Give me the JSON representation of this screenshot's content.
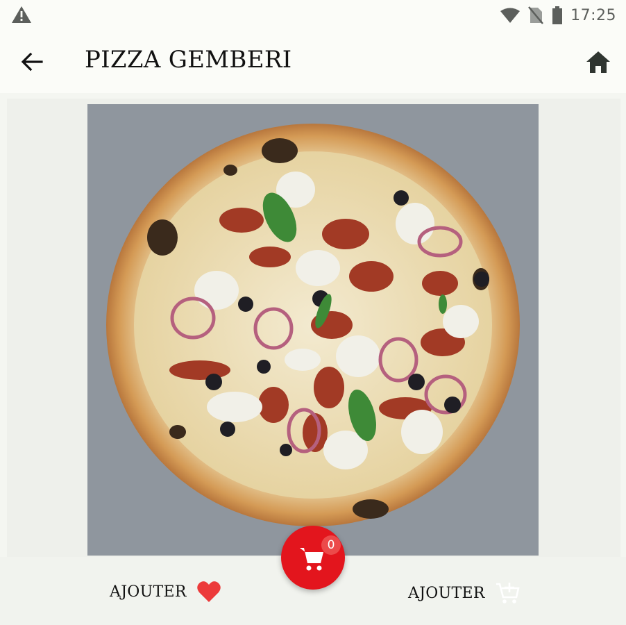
{
  "status_bar": {
    "time": "17:25",
    "icons": [
      "warning-icon",
      "wifi-icon",
      "no-sim-icon",
      "battery-icon"
    ]
  },
  "app_bar": {
    "title": "PIZZA GEMBERI",
    "back_icon": "arrow-back-icon",
    "home_icon": "home-icon"
  },
  "product": {
    "image": "pizza-photo"
  },
  "actions": {
    "favorite_label": "AJOUTER",
    "favorite_icon": "heart-icon",
    "cart_label": "AJOUTER",
    "cart_icon": "add-to-cart-icon"
  },
  "cart_fab": {
    "icon": "cart-icon",
    "count": "0"
  },
  "colors": {
    "accent": "#e3151d",
    "heart": "#ec3a3a",
    "app_bar": "#fbfcf8",
    "background": "#f4f6f1"
  }
}
